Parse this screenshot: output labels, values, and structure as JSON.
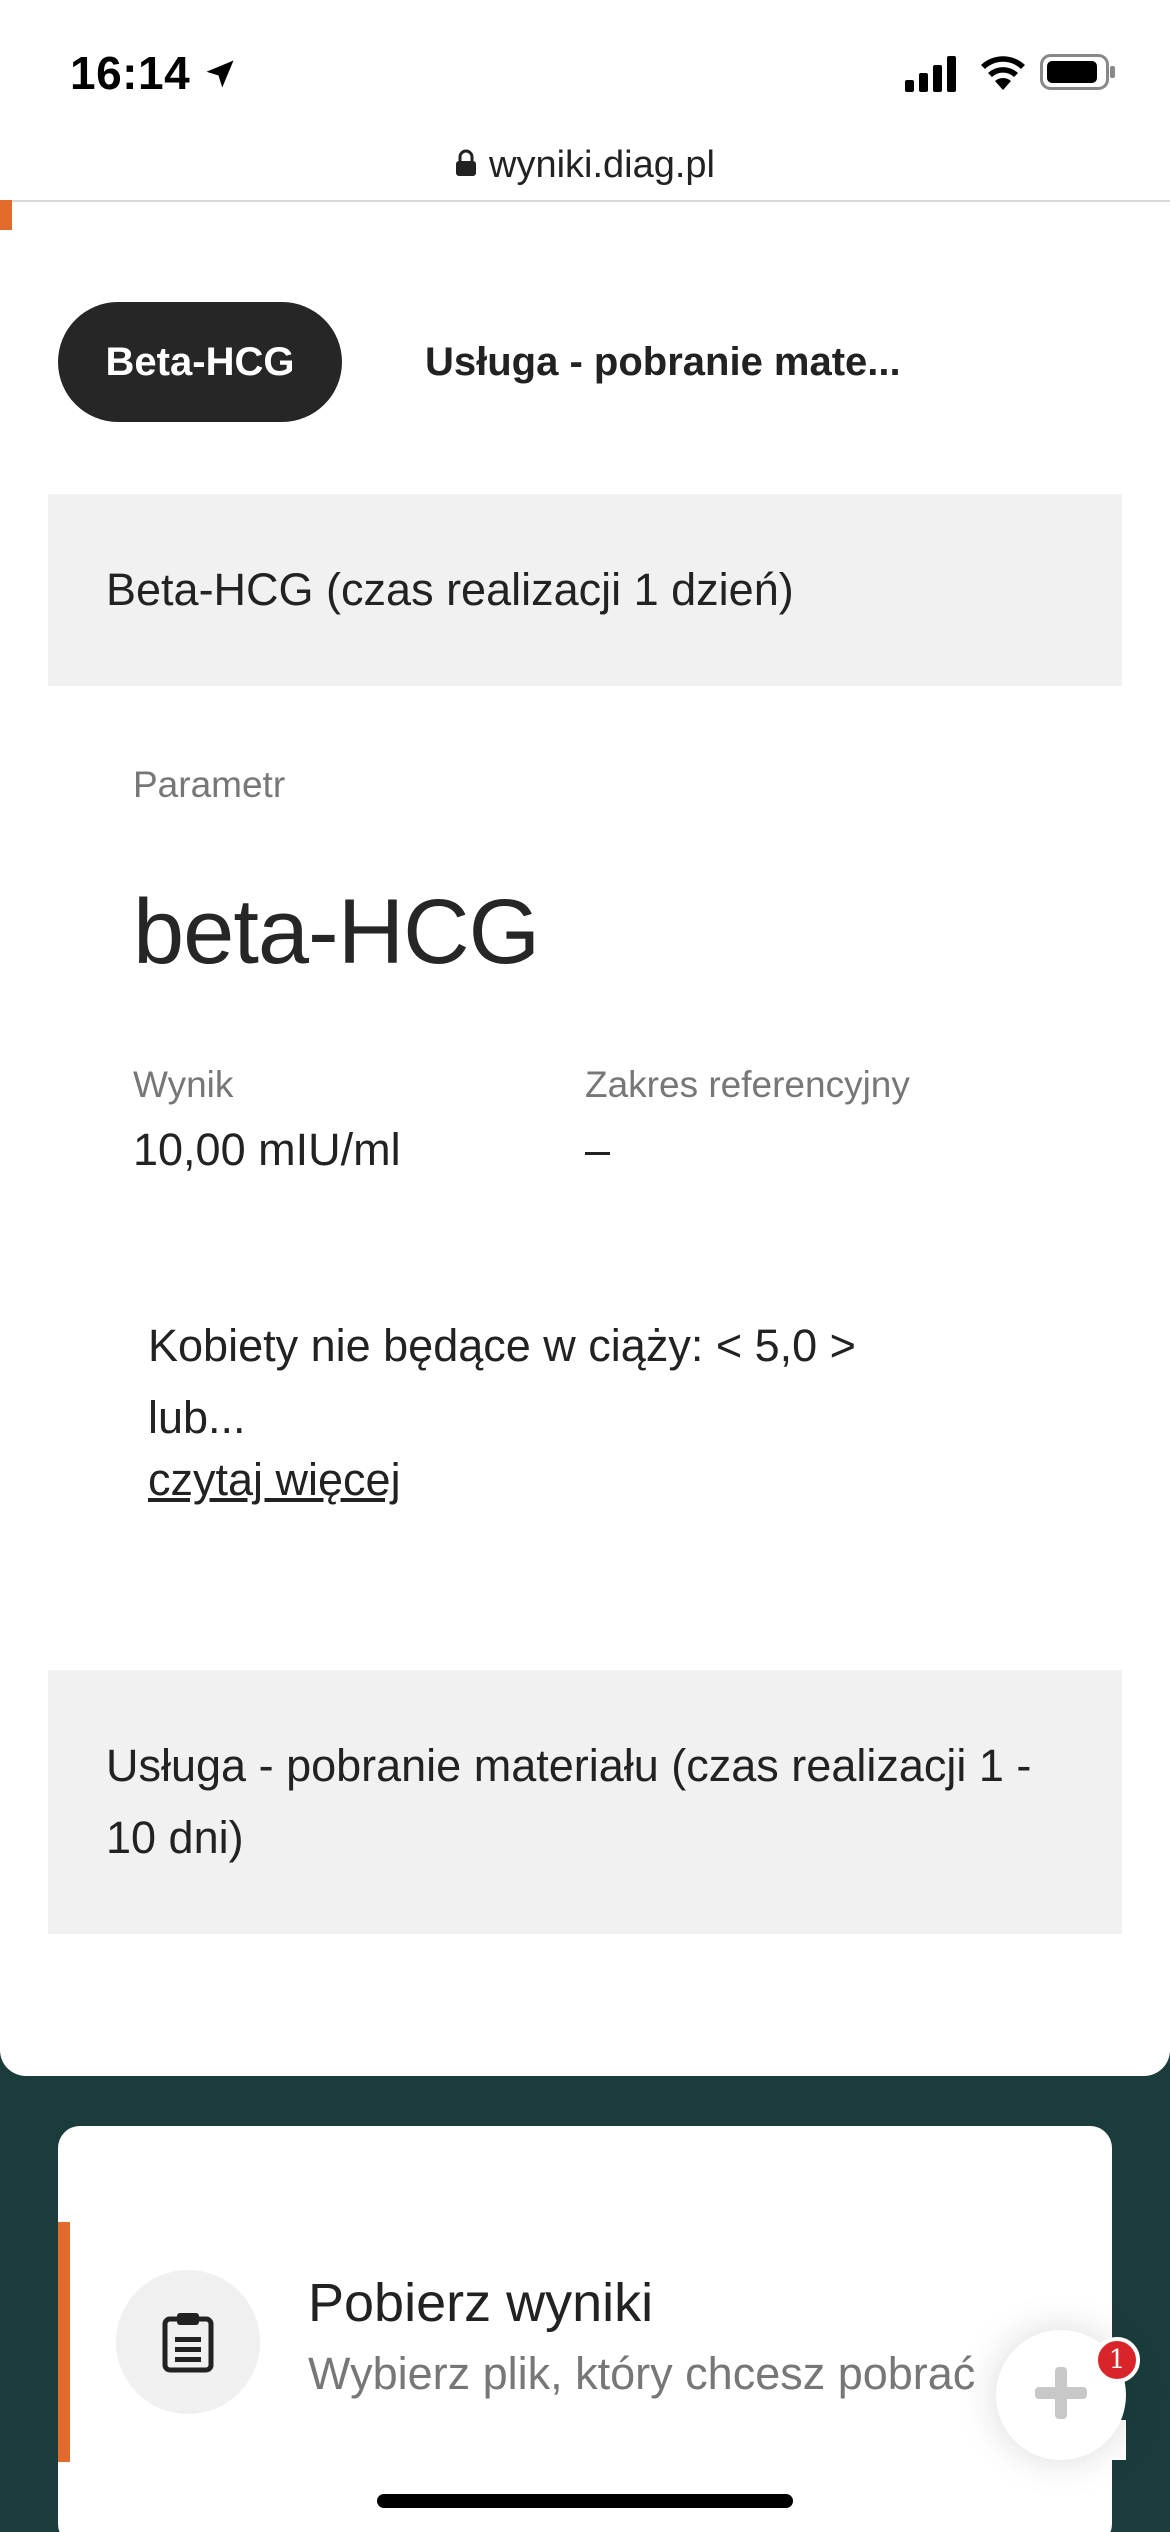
{
  "status_bar": {
    "time": "16:14",
    "icons": [
      "location-arrow-icon",
      "signal-icon",
      "wifi-icon",
      "battery-icon"
    ]
  },
  "browser": {
    "url": "wyniki.diag.pl",
    "lock_icon": "lock-icon"
  },
  "tabs": [
    {
      "label": "Beta-HCG",
      "active": true
    },
    {
      "label": "Usługa - pobranie mate...",
      "active": false
    }
  ],
  "sections": [
    {
      "title": "Beta-HCG (czas realizacji 1 dzień)"
    },
    {
      "title": "Usługa - pobranie materiału (czas realizacji 1 - 10 dni)"
    }
  ],
  "result": {
    "param_label": "Parametr",
    "param_value": "beta-HCG",
    "wynik_label": "Wynik",
    "wynik_value": "10,00 mIU/ml",
    "zakres_label": "Zakres referencyjny",
    "zakres_value": "–",
    "note": "Kobiety nie będące w ciąży: < 5,0 > lub...",
    "read_more": "czytaj więcej"
  },
  "download": {
    "title": "Pobierz wyniki",
    "subtitle": "Wybierz plik, który chcesz pobrać",
    "icon": "clipboard-icon"
  },
  "fab": {
    "icon": "plus-icon",
    "badge_count": "1"
  },
  "colors": {
    "accent_orange": "#e06b2a",
    "footer_bg": "#1a3d3c",
    "tab_active_bg": "#262626",
    "badge_red": "#d9252a"
  }
}
